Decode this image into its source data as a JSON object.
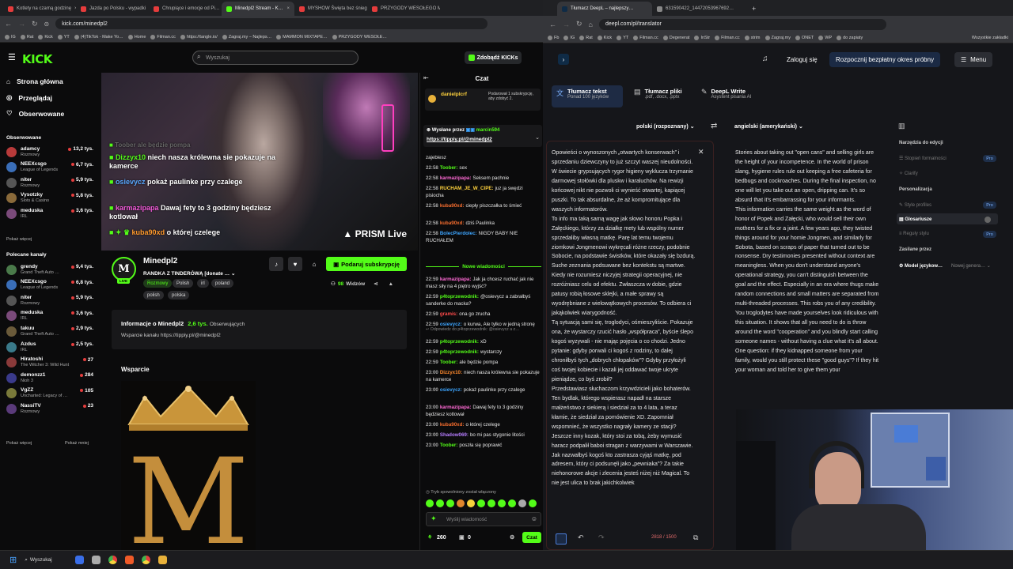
{
  "left_browser": {
    "tabs": [
      {
        "label": "Kotlety na czarną godzinę",
        "color": "#e63c3c"
      },
      {
        "label": "Jazda po Polsku - wypadki",
        "color": "#e63c3c"
      },
      {
        "label": "Chrupiące i emocje od Pi…",
        "color": "#e63c3c"
      },
      {
        "label": "Minedpl2 Stream - K…",
        "color": "#53fc18",
        "active": true
      },
      {
        "label": "MYSHOW Święta bez śniegu",
        "color": "#e63c3c"
      },
      {
        "label": "PRZYGODY WESOŁEGO MA…",
        "color": "#e63c3c"
      }
    ],
    "url": "kick.com/minedpl2",
    "bookmarks": [
      "IG",
      "Rat",
      "Kick",
      "YT",
      "(4)TikTok - Make Yo…",
      "Home",
      "Filman.cc",
      "https://tangle.io/",
      "Zagraj.my – Najleps…",
      "MAMMON MIXTAPE…",
      "PRZYGODY WESOŁE…"
    ]
  },
  "kick": {
    "logo": "KICK",
    "search_placeholder": "Wyszukaj",
    "get_kicks": "Zdobądź KICKs",
    "nav": [
      "Strona główna",
      "Przeglądaj",
      "Obserwowane"
    ],
    "following_header": "Obserwowane",
    "following": [
      {
        "name": "adamcy",
        "game": "Rozmowy",
        "viewers": "13,2 tys.",
        "color": "#b83a3a"
      },
      {
        "name": "NEEXcsgo",
        "game": "League of Legends",
        "viewers": "6,7 tys.",
        "color": "#3a6eb8"
      },
      {
        "name": "niter",
        "game": "Rozmowy",
        "viewers": "5,9 tys.",
        "color": "#555"
      },
      {
        "name": "Vysotzky",
        "game": "Slots & Casino",
        "viewers": "5,8 tys.",
        "color": "#8a6a3a"
      },
      {
        "name": "meduska",
        "game": "IRL",
        "viewers": "3,6 tys.",
        "color": "#7a4a7a"
      }
    ],
    "show_more": "Pokaż więcej",
    "recommended_header": "Polecane kanały",
    "recommended": [
      {
        "name": "grendy",
        "game": "Grand Theft Auto …",
        "viewers": "9,4 tys.",
        "color": "#4a7a4a"
      },
      {
        "name": "NEEXcsgo",
        "game": "League of Legends",
        "viewers": "6,8 tys.",
        "color": "#3a6eb8"
      },
      {
        "name": "niter",
        "game": "Rozmowy",
        "viewers": "5,9 tys.",
        "color": "#555"
      },
      {
        "name": "meduska",
        "game": "IRL",
        "viewers": "3,6 tys.",
        "color": "#7a4a7a"
      },
      {
        "name": "takuu",
        "game": "Grand Theft Auto …",
        "viewers": "2,9 tys.",
        "color": "#6a5a3a"
      },
      {
        "name": "Azdus",
        "game": "IRL",
        "viewers": "2,5 tys.",
        "color": "#3a7a8a"
      },
      {
        "name": "Hiratoshi",
        "game": "The Witcher 3: Wild Hunt",
        "viewers": "27",
        "color": "#8a3a3a"
      },
      {
        "name": "demonzz1",
        "game": "Nioh 3",
        "viewers": "284",
        "color": "#3a3a8a"
      },
      {
        "name": "VgZZ",
        "game": "Uncharted: Legacy of …",
        "viewers": "105",
        "color": "#7a7a3a"
      },
      {
        "name": "NassiTV",
        "game": "Rozmowy",
        "viewers": "23",
        "color": "#5a3a7a"
      }
    ],
    "show_less": "Pokaż mniej",
    "video_overlay": [
      {
        "user": "Dizzyx10",
        "msg": "niech nasza królewna sie pokazuje na kamerce"
      },
      {
        "user": "osievycz",
        "msg": "pokaż paulinke przy czalege"
      },
      {
        "user": "karmazipapa",
        "msg": "Dawaj fety to 3 godziny będziesz kotlował"
      },
      {
        "user": "kuba90xd",
        "msg": "o której czelege"
      }
    ],
    "video_overlay_top": "Toober ale będzie pompa",
    "prism": "PRISM Live",
    "streamer": {
      "name": "Minedpl2",
      "title": "RANDKA Z TINDERÓWĄ [donate …",
      "tags": [
        "Rozmowy",
        "Polish",
        "irl",
        "poland",
        "polish",
        "polska"
      ],
      "viewers": "98",
      "viewers_label": "Widzów",
      "subscribe": "Podaruj subskrypcję"
    },
    "about": {
      "title": "Informacje o Minedpl2",
      "followers": "2,6 tys.",
      "followers_label": "Obserwujących",
      "support_link": "Wsparcie kanału https://tippiy.pl/@minedpl2"
    },
    "support_header": "Wsparcie"
  },
  "chat": {
    "title": "Czat",
    "sub_user": "danielplcrf",
    "sub_text": "Podarował 1 subskrypcję, aby zdobyć 2.",
    "pinned_label": "Wysłane przez",
    "pinned_user": "marcin594",
    "pinned_link": "https://tippiy.pl/@minedpl2",
    "messages": [
      {
        "t": "",
        "u": "",
        "m": "zajebiesz",
        "c": "#fff"
      },
      {
        "t": "22:58",
        "u": "Toober:",
        "m": "sex",
        "c": "#53fc18"
      },
      {
        "t": "22:58",
        "u": "karmazipapa:",
        "m": "Seksem pachnie",
        "c": "#ff6ad5"
      },
      {
        "t": "22:58",
        "u": "RUCHAM_JE_W_CIPE:",
        "m": "juz ja swędzi pisiocha",
        "c": "#ffd23d"
      },
      {
        "t": "22:58",
        "u": "kuba90xd:",
        "m": "ciepły piszczałka to śmieć",
        "c": "#f56d2e"
      },
      {
        "t": "22:58",
        "u": "kuba90xd:",
        "m": "dziś Paulinka",
        "c": "#f56d2e"
      },
      {
        "t": "22:58",
        "u": "BolecPierdolec:",
        "m": "NIGDY BABY NIE RUCHAŁEM",
        "c": "#3da5ff"
      }
    ],
    "new_messages": "Nowe wiadomości",
    "messages2": [
      {
        "t": "22:59",
        "u": "karmazipapa:",
        "m": "Jak ja chcesz ruchać jak nie masz siły na 4 piętro wyjść?",
        "c": "#ff6ad5"
      },
      {
        "t": "22:59",
        "u": "p4toprzewodnik:",
        "m": "@osievycz a zabrałbyś sanderke do macka?",
        "c": "#53fc18"
      },
      {
        "t": "22:59",
        "u": "gramis:",
        "m": "ona go zrucha",
        "c": "#ff4b4b"
      },
      {
        "t": "22:59",
        "u": "osievycz:",
        "m": "o kurwa, Ale tylko w jedną stronę",
        "c": "#3da5ff"
      },
      {
        "t": "22:59",
        "u": "p4toprzewodnik:",
        "m": "xD",
        "c": "#53fc18"
      },
      {
        "t": "22:59",
        "u": "p4toprzewodnik:",
        "m": "wystarczy",
        "c": "#53fc18"
      },
      {
        "t": "22:59",
        "u": "Toober:",
        "m": "ale będzie pompa",
        "c": "#53fc18"
      },
      {
        "t": "23:00",
        "u": "Dizzyx10:",
        "m": "niech nasza królewna sie pokazuje na kamerce",
        "c": "#ff8a2d"
      },
      {
        "t": "23:00",
        "u": "osievycz:",
        "m": "pokaż paulinke przy czalege",
        "c": "#3da5ff"
      },
      {
        "t": "23:00",
        "u": "karmazipapa:",
        "m": "Dawaj fety to 3 godziny będziesz kotlował",
        "c": "#ff6ad5"
      },
      {
        "t": "23:00",
        "u": "kuba90xd:",
        "m": "o której czelege",
        "c": "#f56d2e"
      },
      {
        "t": "23:00",
        "u": "Shadow069:",
        "m": "bo mi pas stygonie litości",
        "c": "#b67dff"
      },
      {
        "t": "23:00",
        "u": "Toober:",
        "m": "poszła się poprawić",
        "c": "#53fc18"
      }
    ],
    "reply_note": "Odpowiedz do p4toprzewodnik: @osievycz a z…",
    "slow_mode": "Tryb spowolniony został włączony",
    "input_placeholder": "Wyślij wiadomość",
    "points": "260",
    "bits": "0",
    "send": "Czat"
  },
  "right_browser": {
    "tabs": [
      {
        "label": "Tłumacz DeepL – najlepszy…",
        "active": true
      },
      {
        "label": "631590422_14472053967692…",
        "active": false
      }
    ],
    "url": "deepl.com/pl/translator",
    "bookmarks": [
      "Fb",
      "IG",
      "Rat",
      "Kick",
      "YT",
      "Filman.cc",
      "Degenerat",
      "InStr",
      "Filman.cc",
      "strim",
      "Zagraj.my",
      "ONET",
      "WP",
      "do zapiaty"
    ],
    "bookmarks_all": "Wszystkie zakładki"
  },
  "deepl": {
    "login": "Zaloguj się",
    "trial": "Rozpocznij bezpłatny okres próbny",
    "menu": "Menu",
    "tabs": [
      {
        "title": "Tłumacz tekst",
        "sub": "Ponad 100 języków"
      },
      {
        "title": "Tłumacz pliki",
        "sub": ".pdf, .docx, .pptx"
      },
      {
        "title": "DeepL Write",
        "sub": "Asystent pisania AI"
      }
    ],
    "source_lang": "polski (rozpoznany)",
    "target_lang": "angielski (amerykański)",
    "source_text": "Opowieści o wynoszonych „otwartych konserwach” i sprzedaniu dziewczyny to już szczyt waszej nieudolności. W świecie grypsujących rygor higieny wyklucza trzymanie darmowej stołówki dla pluskw i karaluchów. Na rewizji końcowej nikt nie pozwoli ci wynieść otwartej, kapiącej puszki. To tak absurdalne, że aż kompromitujące dla waszych informatorów.\nTo info ma taką samą wagę jak słowo honoru Popka i Załęckiego, którzy za działkę mety lub wspólny numer sprzedaliby własną matkę. Parę lat temu twojemu ziomkowi Jongmenowi wykręcali różne rzeczy, podobnie Sobocie, na podstawie świstków, które okazały się bzdurą. Suche zeznania podsuwane bez kontekstu są martwe. Kiedy nie rozumiesz niczyjej strategii operacyjnej, nie rozróżniasz celu od efektu. Zwłaszcza w dobie, gdzie patusy robią łosowe sklejki, a małe sprawy są wyodrębniane z wielowątkowych procesów. To odbiera ci jakąkolwiek wiarygodność.\nTą sytuacją sami się, troglodyci, ośmieszyliście. Pokazuje ona, że wystarczy rzucić hasło „współpraca”, byście ślepo kogoś wyzywali - nie mając pojęcia o co chodzi. Jedno pytanie: gdyby porwali ci kogoś z rodziny, to dalej chroniłbyś tych „dobrych chłopaków”? Gdyby przyłożyli coś twojej kobiecie i kazali jej oddawać twoje ukryte pieniądze, co byś zrobił?\nPrzedstawiasz słuchaczom krzywdzicieli jako bohaterów. Ten bydlak, którego wspierasz napadł na starsze małżeństwo z siekierą i siedział za to 4 lata, a teraz kłamie, że siedział za pomówienie XD. Zapomniał wspomnieć, że wszystko nagrały kamery ze stacji? Jeszcze inny kozak, który stoi za tobą, żeby wymusić haracz podpalił baboi stragan z warzywami w Warszawie.\nJak nazwałbyś kogoś kto zastrasza cyjąś matkę, pod adresem, który ci podsunęli jako „pewniaka”? Za takie niehonorowe akcje i zlecenia jesteś niżej niż Magical. To nie jest ulica to brak jakichkolwiek",
    "target_text": "Stories about taking out \"open cans\" and selling girls are the height of your incompetence. In the world of prison slang, hygiene rules rule out keeping a free cafeteria for bedbugs and cockroaches. During the final inspection, no one will let you take out an open, dripping can. It's so absurd that it's embarrassing for your informants.\nThis information carries the same weight as the word of honor of Popek and Załęcki, who would sell their own mothers for a fix or a joint. A few years ago, they twisted things around for your homie Jongmen, and similarly for Sobota, based on scraps of paper that turned out to be nonsense. Dry testimonies presented without context are meaningless. When you don't understand anyone's operational strategy, you can't distinguish between the goal and the effect. Especially in an era where thugs make random connections and small matters are separated from multi-threaded processes. This robs you of any credibility.\nYou troglodytes have made yourselves look ridiculous with this situation. It shows that all you need to do is throw around the word \"cooperation\" and you blindly start calling someone names - without having a clue what it's all about. One question: if they kidnapped someone from your family, would you still protect these \"good guys\"? If they hit your woman and told her to give them your",
    "char_count": "2818 / 1500",
    "panel": {
      "tools_header": "Narzędzia do edycji",
      "tools": [
        {
          "label": "Stopień formalności",
          "pro": true
        },
        {
          "label": "Clarify",
          "pro": false
        }
      ],
      "personal_header": "Personalizacja",
      "personal": [
        {
          "label": "Style profiles",
          "pro": true
        },
        {
          "label": "Glosariusze",
          "pro": false
        },
        {
          "label": "Reguły stylu",
          "pro": true
        }
      ],
      "powered_header": "Zasilane przez",
      "model": "Model językow…",
      "model_value": "Nowej genera…",
      "pro_label": "Pro"
    }
  },
  "taskbar": {
    "search": "Wyszukaj"
  }
}
